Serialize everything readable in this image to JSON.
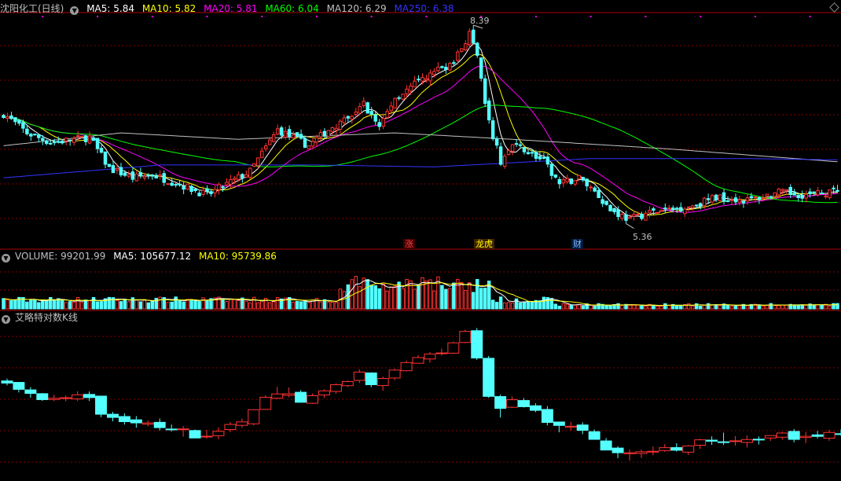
{
  "price_header": {
    "stock_name": "沈阳化工(日线)",
    "ma": [
      {
        "label": "MA5: 5.84",
        "color": "#ffffff"
      },
      {
        "label": "MA10: 5.82",
        "color": "#ffff00"
      },
      {
        "label": "MA20: 5.81",
        "color": "#ff00ff"
      },
      {
        "label": "MA60: 6.04",
        "color": "#00ff00"
      },
      {
        "label": "MA120: 6.29",
        "color": "#c0c0c0"
      },
      {
        "label": "MA250: 6.38",
        "color": "#3333ff"
      }
    ]
  },
  "volume_header": {
    "items": [
      {
        "label": "VOLUME: 99201.99",
        "color": "#c0c0c0"
      },
      {
        "label": "MA5: 105677.12",
        "color": "#ffffff"
      },
      {
        "label": "MA10: 95739.86",
        "color": "#ffff00"
      }
    ]
  },
  "indicator_header": {
    "title": "艾略特对数K线"
  },
  "annotations": {
    "high": "8.39",
    "low": "5.36",
    "zhang": "涨",
    "longhu": "龙虎",
    "cai": "财"
  },
  "colors": {
    "up": "#ff3232",
    "down": "#54ffff",
    "grid": "#800000",
    "ma5": "#ffffff",
    "ma10": "#ffff00",
    "ma20": "#ff00ff",
    "ma60": "#00ff00",
    "ma120": "#c0c0c0",
    "ma250": "#3333ff"
  },
  "chart_data": {
    "type": "candlestick",
    "price_range": [
      5.0,
      8.6
    ],
    "keyframes": [
      {
        "i": 0,
        "p": 7.05
      },
      {
        "i": 6,
        "p": 6.75
      },
      {
        "i": 12,
        "p": 6.6
      },
      {
        "i": 22,
        "p": 6.68
      },
      {
        "i": 27,
        "p": 6.2
      },
      {
        "i": 33,
        "p": 6.05
      },
      {
        "i": 38,
        "p": 6.1
      },
      {
        "i": 45,
        "p": 5.95
      },
      {
        "i": 52,
        "p": 5.78
      },
      {
        "i": 56,
        "p": 5.92
      },
      {
        "i": 63,
        "p": 6.15
      },
      {
        "i": 70,
        "p": 6.8
      },
      {
        "i": 78,
        "p": 6.55
      },
      {
        "i": 84,
        "p": 6.85
      },
      {
        "i": 88,
        "p": 6.95
      },
      {
        "i": 92,
        "p": 7.2
      },
      {
        "i": 96,
        "p": 6.85
      },
      {
        "i": 100,
        "p": 7.3
      },
      {
        "i": 105,
        "p": 7.5
      },
      {
        "i": 110,
        "p": 7.7
      },
      {
        "i": 115,
        "p": 7.85
      },
      {
        "i": 119,
        "p": 8.3
      },
      {
        "i": 121,
        "p": 7.9
      },
      {
        "i": 124,
        "p": 6.9
      },
      {
        "i": 127,
        "p": 6.3
      },
      {
        "i": 130,
        "p": 6.55
      },
      {
        "i": 133,
        "p": 6.5
      },
      {
        "i": 138,
        "p": 6.3
      },
      {
        "i": 142,
        "p": 5.95
      },
      {
        "i": 147,
        "p": 6.05
      },
      {
        "i": 151,
        "p": 5.85
      },
      {
        "i": 155,
        "p": 5.55
      },
      {
        "i": 160,
        "p": 5.4
      },
      {
        "i": 164,
        "p": 5.5
      },
      {
        "i": 170,
        "p": 5.55
      },
      {
        "i": 176,
        "p": 5.62
      },
      {
        "i": 182,
        "p": 5.75
      },
      {
        "i": 190,
        "p": 5.7
      },
      {
        "i": 198,
        "p": 5.82
      },
      {
        "i": 206,
        "p": 5.78
      },
      {
        "i": 213,
        "p": 5.84
      }
    ],
    "ma120_keys": [
      {
        "i": 0,
        "p": 6.55
      },
      {
        "i": 30,
        "p": 6.75
      },
      {
        "i": 60,
        "p": 6.65
      },
      {
        "i": 100,
        "p": 6.75
      },
      {
        "i": 130,
        "p": 6.65
      },
      {
        "i": 170,
        "p": 6.5
      },
      {
        "i": 213,
        "p": 6.3
      }
    ],
    "ma250_keys": [
      {
        "i": 0,
        "p": 6.05
      },
      {
        "i": 40,
        "p": 6.25
      },
      {
        "i": 80,
        "p": 6.25
      },
      {
        "i": 110,
        "p": 6.22
      },
      {
        "i": 150,
        "p": 6.35
      },
      {
        "i": 190,
        "p": 6.35
      },
      {
        "i": 213,
        "p": 6.33
      }
    ],
    "volume_range": [
      0,
      300000
    ],
    "current": {
      "close": 5.84,
      "ma5": 5.84,
      "ma10": 5.82,
      "ma20": 5.81,
      "ma60": 6.04,
      "ma120": 6.29,
      "ma250": 6.38
    }
  }
}
